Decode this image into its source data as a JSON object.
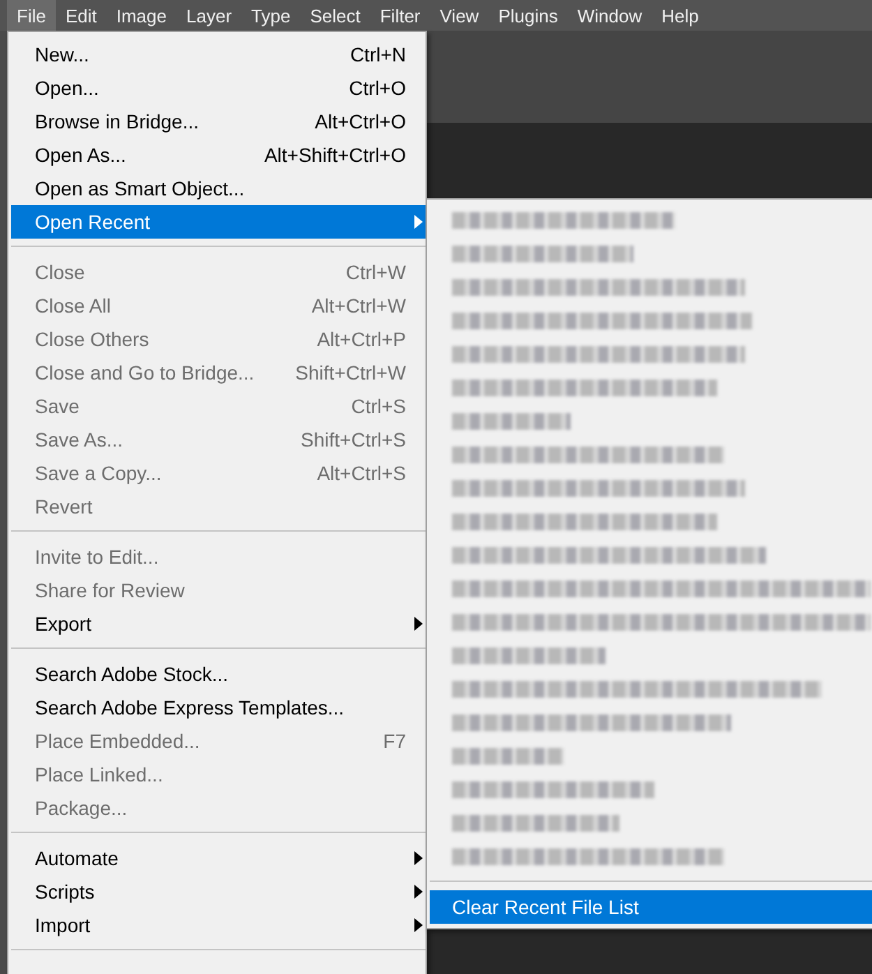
{
  "menubar": [
    {
      "label": "File",
      "selected": true
    },
    {
      "label": "Edit",
      "selected": false
    },
    {
      "label": "Image",
      "selected": false
    },
    {
      "label": "Layer",
      "selected": false
    },
    {
      "label": "Type",
      "selected": false
    },
    {
      "label": "Select",
      "selected": false
    },
    {
      "label": "Filter",
      "selected": false
    },
    {
      "label": "View",
      "selected": false
    },
    {
      "label": "Plugins",
      "selected": false
    },
    {
      "label": "Window",
      "selected": false
    },
    {
      "label": "Help",
      "selected": false
    }
  ],
  "file_menu": [
    {
      "kind": "item",
      "label": "New...",
      "shortcut": "Ctrl+N",
      "disabled": false,
      "selected": false,
      "submenu": false
    },
    {
      "kind": "item",
      "label": "Open...",
      "shortcut": "Ctrl+O",
      "disabled": false,
      "selected": false,
      "submenu": false
    },
    {
      "kind": "item",
      "label": "Browse in Bridge...",
      "shortcut": "Alt+Ctrl+O",
      "disabled": false,
      "selected": false,
      "submenu": false
    },
    {
      "kind": "item",
      "label": "Open As...",
      "shortcut": "Alt+Shift+Ctrl+O",
      "disabled": false,
      "selected": false,
      "submenu": false
    },
    {
      "kind": "item",
      "label": "Open as Smart Object...",
      "disabled": false,
      "selected": false,
      "submenu": false
    },
    {
      "kind": "item",
      "label": "Open Recent",
      "disabled": false,
      "selected": true,
      "submenu": true
    },
    {
      "kind": "separator"
    },
    {
      "kind": "item",
      "label": "Close",
      "shortcut": "Ctrl+W",
      "disabled": true,
      "selected": false,
      "submenu": false
    },
    {
      "kind": "item",
      "label": "Close All",
      "shortcut": "Alt+Ctrl+W",
      "disabled": true,
      "selected": false,
      "submenu": false
    },
    {
      "kind": "item",
      "label": "Close Others",
      "shortcut": "Alt+Ctrl+P",
      "disabled": true,
      "selected": false,
      "submenu": false
    },
    {
      "kind": "item",
      "label": "Close and Go to Bridge...",
      "shortcut": "Shift+Ctrl+W",
      "disabled": true,
      "selected": false,
      "submenu": false
    },
    {
      "kind": "item",
      "label": "Save",
      "shortcut": "Ctrl+S",
      "disabled": true,
      "selected": false,
      "submenu": false
    },
    {
      "kind": "item",
      "label": "Save As...",
      "shortcut": "Shift+Ctrl+S",
      "disabled": true,
      "selected": false,
      "submenu": false
    },
    {
      "kind": "item",
      "label": "Save a Copy...",
      "shortcut": "Alt+Ctrl+S",
      "disabled": true,
      "selected": false,
      "submenu": false
    },
    {
      "kind": "item",
      "label": "Revert",
      "disabled": true,
      "selected": false,
      "submenu": false
    },
    {
      "kind": "separator"
    },
    {
      "kind": "item",
      "label": "Invite to Edit...",
      "disabled": true,
      "selected": false,
      "submenu": false
    },
    {
      "kind": "item",
      "label": "Share for Review",
      "disabled": true,
      "selected": false,
      "submenu": false
    },
    {
      "kind": "item",
      "label": "Export",
      "disabled": false,
      "selected": false,
      "submenu": true
    },
    {
      "kind": "separator"
    },
    {
      "kind": "item",
      "label": "Search Adobe Stock...",
      "disabled": false,
      "selected": false,
      "submenu": false
    },
    {
      "kind": "item",
      "label": "Search Adobe Express Templates...",
      "disabled": false,
      "selected": false,
      "submenu": false
    },
    {
      "kind": "item",
      "label": "Place Embedded...",
      "shortcut": "F7",
      "disabled": true,
      "selected": false,
      "submenu": false
    },
    {
      "kind": "item",
      "label": "Place Linked...",
      "disabled": true,
      "selected": false,
      "submenu": false
    },
    {
      "kind": "item",
      "label": "Package...",
      "disabled": true,
      "selected": false,
      "submenu": false
    },
    {
      "kind": "separator"
    },
    {
      "kind": "item",
      "label": "Automate",
      "disabled": false,
      "selected": false,
      "submenu": true
    },
    {
      "kind": "item",
      "label": "Scripts",
      "disabled": false,
      "selected": false,
      "submenu": true
    },
    {
      "kind": "item",
      "label": "Import",
      "disabled": false,
      "selected": false,
      "submenu": true
    },
    {
      "kind": "separator"
    }
  ],
  "recent_menu": [
    {
      "kind": "blurred"
    },
    {
      "kind": "blurred"
    },
    {
      "kind": "blurred"
    },
    {
      "kind": "blurred"
    },
    {
      "kind": "blurred"
    },
    {
      "kind": "blurred"
    },
    {
      "kind": "blurred"
    },
    {
      "kind": "blurred"
    },
    {
      "kind": "blurred"
    },
    {
      "kind": "blurred"
    },
    {
      "kind": "blurred"
    },
    {
      "kind": "blurred"
    },
    {
      "kind": "blurred"
    },
    {
      "kind": "blurred"
    },
    {
      "kind": "blurred"
    },
    {
      "kind": "blurred"
    },
    {
      "kind": "blurred"
    },
    {
      "kind": "blurred"
    },
    {
      "kind": "blurred"
    },
    {
      "kind": "blurred"
    },
    {
      "kind": "separator"
    },
    {
      "kind": "item",
      "label": "Clear Recent File List",
      "selected": true
    }
  ]
}
